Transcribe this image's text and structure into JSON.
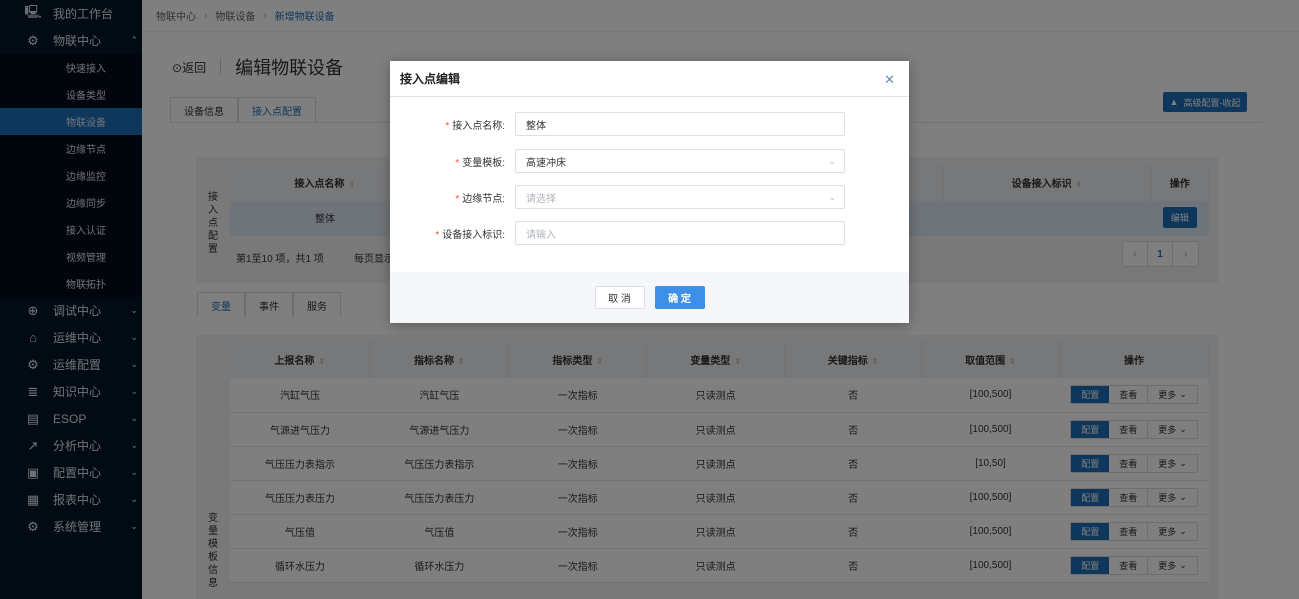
{
  "sidebar": {
    "top": [
      {
        "label": "我的工作台",
        "icon": "monitor-icon"
      },
      {
        "label": "物联中心",
        "icon": "robot-arm-icon",
        "expanded": true
      }
    ],
    "sub": [
      "快速接入",
      "设备类型",
      "物联设备",
      "边缘节点",
      "边缘监控",
      "边缘同步",
      "接入认证",
      "视频管理",
      "物联拓扑"
    ],
    "active_sub": "物联设备",
    "groups": [
      {
        "label": "调试中心",
        "icon": "debug-icon"
      },
      {
        "label": "运维中心",
        "icon": "house-wrench-icon"
      },
      {
        "label": "运维配置",
        "icon": "gear-wrench-icon"
      },
      {
        "label": "知识中心",
        "icon": "database-icon"
      },
      {
        "label": "ESOP",
        "icon": "esop-icon"
      },
      {
        "label": "分析中心",
        "icon": "chart-icon"
      },
      {
        "label": "配置中心",
        "icon": "toolbox-icon"
      },
      {
        "label": "报表中心",
        "icon": "report-icon"
      },
      {
        "label": "系统管理",
        "icon": "settings-icon"
      }
    ]
  },
  "breadcrumb": [
    "物联中心",
    "物联设备",
    "新增物联设备"
  ],
  "header": {
    "back": "返回",
    "title": "编辑物联设备",
    "advanced_button": "高级配置-收起"
  },
  "tabs": [
    "设备信息",
    "接入点配置"
  ],
  "access_panel": {
    "side_label": [
      "接",
      "入",
      "点",
      "配",
      "置"
    ],
    "columns": [
      "接入点名称",
      "设备接入标识",
      "操作"
    ],
    "rows": [
      {
        "name": "整体",
        "id": "",
        "action": "编辑"
      }
    ],
    "pagination_text": "第1至10 项，共1  项",
    "page_size_text": "每页显示",
    "page": "1"
  },
  "sub_tabs": [
    "变量",
    "事件",
    "服务"
  ],
  "var_panel": {
    "side_label": [
      "变",
      "量",
      "模",
      "板",
      "信",
      "息"
    ],
    "columns": [
      "上报名称",
      "指标名称",
      "指标类型",
      "变量类型",
      "关键指标",
      "取值范围",
      "操作"
    ],
    "rows": [
      [
        "汽缸气压",
        "汽缸气压",
        "一次指标",
        "只读测点",
        "否",
        "[100,500]"
      ],
      [
        "气源进气压力",
        "气源进气压力",
        "一次指标",
        "只读测点",
        "否",
        "[100,500]"
      ],
      [
        "气压压力表指示",
        "气压压力表指示",
        "一次指标",
        "只读测点",
        "否",
        "[10,50]"
      ],
      [
        "气压压力表压力",
        "气压压力表压力",
        "一次指标",
        "只读测点",
        "否",
        "[100,500]"
      ],
      [
        "气压值",
        "气压值",
        "一次指标",
        "只读测点",
        "否",
        "[100,500]"
      ],
      [
        "循环水压力",
        "循环水压力",
        "一次指标",
        "只读测点",
        "否",
        "[100,500]"
      ]
    ],
    "actions": {
      "config": "配置",
      "view": "查看",
      "more": "更多"
    }
  },
  "modal": {
    "title": "接入点编辑",
    "fields": [
      {
        "label": "接入点名称:",
        "value": "整体",
        "placeholder": ""
      },
      {
        "label": "变量模板:",
        "value": "高速冲床",
        "placeholder": "",
        "select": true
      },
      {
        "label": "边缘节点:",
        "value": "",
        "placeholder": "请选择",
        "select": true
      },
      {
        "label": "设备接入标识:",
        "value": "",
        "placeholder": "请输入"
      }
    ],
    "cancel": "取 消",
    "ok": "确 定"
  },
  "colors": {
    "accent": "#1f6fb8",
    "sidebar": "#041527",
    "required": "#e45c2f"
  }
}
